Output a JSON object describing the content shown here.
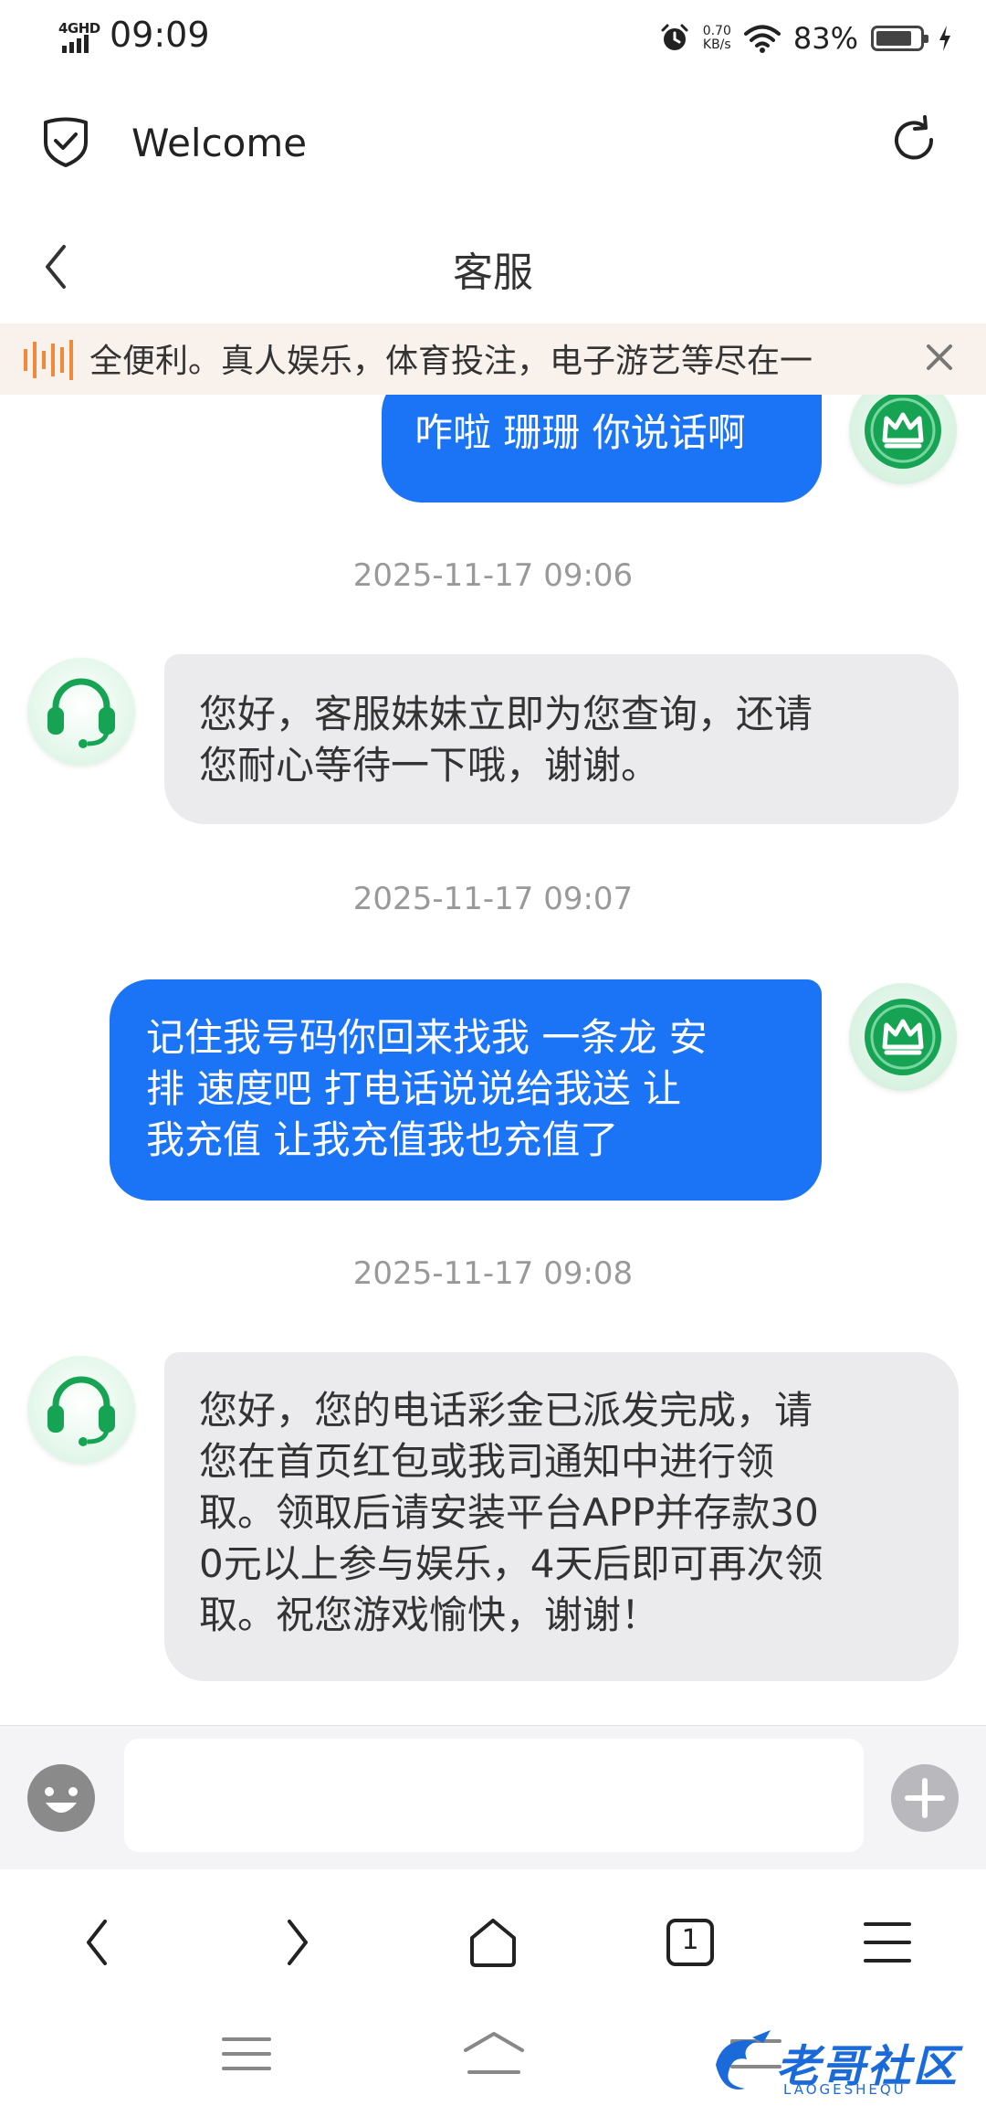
{
  "status_bar": {
    "network": "4GHD",
    "time": "09:09",
    "speed_value": "0.70",
    "speed_unit": "KB/s",
    "battery_percent": "83%",
    "battery_level": 0.83,
    "icons": [
      "signal-icon",
      "alarm-icon",
      "wifi-icon",
      "battery-icon",
      "charging-icon"
    ]
  },
  "browser": {
    "page_title": "Welcome",
    "icons": [
      "shield-check-icon",
      "refresh-icon"
    ]
  },
  "chat": {
    "title": "客服",
    "marquee": "全便利。真人娱乐，体育投注，电子游艺等尽在一",
    "messages": [
      {
        "side": "out",
        "lines": [
          "咋啦 珊珊 你说话啊"
        ]
      },
      {
        "side": "time",
        "text": "2025-11-17 09:06"
      },
      {
        "side": "in",
        "lines": [
          "您好，客服妹妹立即为您查询，还请",
          "您耐心等待一下哦，谢谢。"
        ]
      },
      {
        "side": "time",
        "text": "2025-11-17 09:07"
      },
      {
        "side": "out",
        "lines": [
          "记住我号码你回来找我 一条龙 安",
          "排 速度吧 打电话说说给我送 让",
          "我充值 让我充值我也充值了"
        ]
      },
      {
        "side": "time",
        "text": "2025-11-17 09:08"
      },
      {
        "side": "in",
        "lines": [
          "您好，您的电话彩金已派发完成，请",
          "您在首页红包或我司通知中进行领",
          "取。领取后请安装平台APP并存款30",
          "0元以上参与娱乐，4天后即可再次领",
          "取。祝您游戏愉快，谢谢！"
        ]
      }
    ]
  },
  "input": {
    "value": "",
    "placeholder": ""
  },
  "browser_nav": {
    "tab_count": "1",
    "icons": [
      "back-icon",
      "forward-icon",
      "home-icon",
      "tabs-icon",
      "menu-icon"
    ]
  },
  "system_nav": {
    "icons": [
      "recents-icon",
      "home-icon",
      "back-icon"
    ]
  },
  "watermark": {
    "text": "老哥社区",
    "sub": "LAOGESHEQU"
  },
  "colors": {
    "outgoing_bubble": "#1b73f5",
    "incoming_bubble": "#ebebee",
    "accent_green": "#16a454",
    "marquee_bg": "#f8f1ec",
    "marquee_icon": "#f08a3a"
  }
}
